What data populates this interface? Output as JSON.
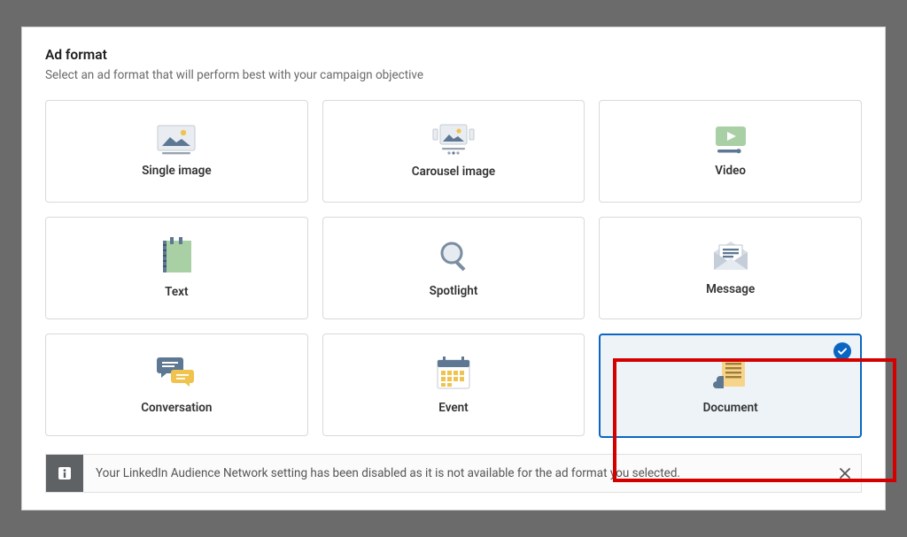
{
  "header": {
    "title": "Ad format",
    "subtitle": "Select an ad format that will perform best with your campaign objective"
  },
  "cards": [
    {
      "label": "Single image",
      "selected": false
    },
    {
      "label": "Carousel image",
      "selected": false
    },
    {
      "label": "Video",
      "selected": false
    },
    {
      "label": "Text",
      "selected": false
    },
    {
      "label": "Spotlight",
      "selected": false
    },
    {
      "label": "Message",
      "selected": false
    },
    {
      "label": "Conversation",
      "selected": false
    },
    {
      "label": "Event",
      "selected": false
    },
    {
      "label": "Document",
      "selected": true
    }
  ],
  "info": {
    "text": "Your LinkedIn Audience Network setting has been disabled as it is not available for the ad format you selected."
  },
  "colors": {
    "accent": "#0a66c2",
    "highlight": "#d40000",
    "pale": "#eef3f8"
  }
}
